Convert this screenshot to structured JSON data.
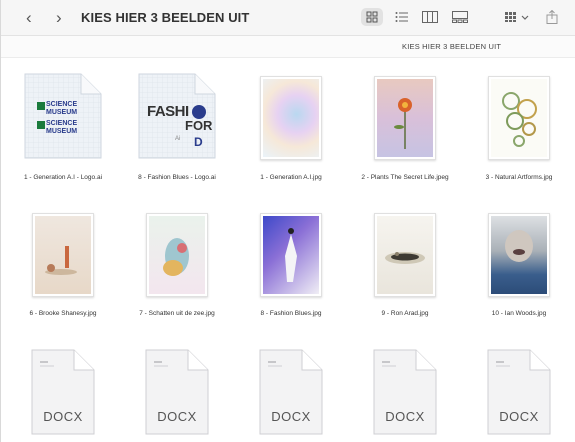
{
  "toolbar": {
    "back_icon": "chevron-left-icon",
    "forward_icon": "chevron-right-icon",
    "title": "KIES HIER 3 BEELDEN UIT",
    "view_buttons": [
      "icon-view-icon",
      "list-view-icon",
      "column-view-icon",
      "gallery-view-icon",
      "group-by-icon",
      "share-icon"
    ]
  },
  "pathbar": {
    "crumb": "KIES HIER 3 BEELDEN UIT"
  },
  "files": [
    {
      "name": "1 - Generation A.I - Logo.ai",
      "kind": "ai-logo-science"
    },
    {
      "name": "8 - Fashion Blues - Logo.ai",
      "kind": "ai-logo-fashion"
    },
    {
      "name": "1 - Generation A.I.jpg",
      "kind": "photo"
    },
    {
      "name": "2 - Plants The Secret Life.jpeg",
      "kind": "photo"
    },
    {
      "name": "3 - Natural Artforms.jpg",
      "kind": "photo"
    },
    {
      "name": "6 - Brooke Shanesy.jpg",
      "kind": "photo"
    },
    {
      "name": "7 - Schatten uit de zee.jpg",
      "kind": "photo"
    },
    {
      "name": "8 - Fashion Blues.jpg",
      "kind": "photo"
    },
    {
      "name": "9 - Ron Arad.jpg",
      "kind": "photo"
    },
    {
      "name": "10 - Ian Woods.jpg",
      "kind": "photo"
    },
    {
      "name": "",
      "kind": "docx"
    },
    {
      "name": "",
      "kind": "docx"
    },
    {
      "name": "",
      "kind": "docx"
    },
    {
      "name": "",
      "kind": "docx"
    },
    {
      "name": "",
      "kind": "docx"
    }
  ],
  "logo_text": {
    "science_a": "SCIENCE",
    "science_b": "MUSEUM",
    "fashion_a": "FASHI",
    "fashion_b": "FOR",
    "fashion_c": "D",
    "fashion_ai": "Ai"
  },
  "doc_type": "DOCX",
  "colors": {
    "accent_green": "#1a7a3c",
    "accent_blue": "#2a3c8c",
    "toolbar_bg": "#f6f6f6"
  }
}
